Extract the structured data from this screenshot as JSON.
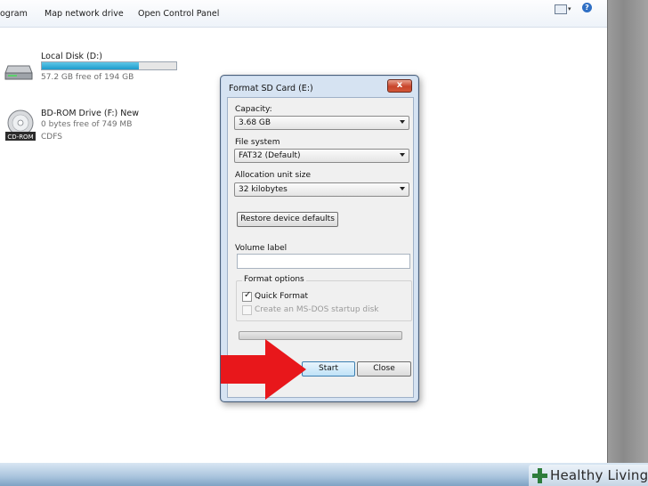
{
  "toolbar": {
    "program_label": "ogram",
    "map_network_drive": "Map network drive",
    "open_control_panel": "Open Control Panel",
    "help_icon": "?"
  },
  "drives": {
    "local_disk": {
      "name": "Local Disk (D:)",
      "free": "57.2 GB free of 194 GB",
      "used_fraction": 0.72,
      "icon": "hard-disk-icon"
    },
    "bd_rom": {
      "name": "BD-ROM Drive (F:) New",
      "free": "0 bytes free of 749 MB",
      "filesystem": "CDFS",
      "icon": "cd-rom-icon",
      "icon_text": "CD-ROM"
    }
  },
  "dialog": {
    "title": "Format SD Card (E:)",
    "close_glyph": "x",
    "capacity_label": "Capacity:",
    "capacity_value": "3.68 GB",
    "filesystem_label": "File system",
    "filesystem_value": "FAT32 (Default)",
    "allocation_label": "Allocation unit size",
    "allocation_value": "32 kilobytes",
    "restore_button": "Restore device defaults",
    "volume_label": "Volume label",
    "volume_value": "",
    "format_options_label": "Format options",
    "quick_format_label": "Quick Format",
    "quick_format_checked": true,
    "msdos_label": "Create an MS-DOS startup disk",
    "msdos_checked": false,
    "progress": 0,
    "start_button": "Start",
    "close_button": "Close"
  },
  "annotation": {
    "arrow_color": "#e8171b"
  },
  "watermark": {
    "text": "Healthy Living",
    "plus_color": "#2e7d3c"
  }
}
